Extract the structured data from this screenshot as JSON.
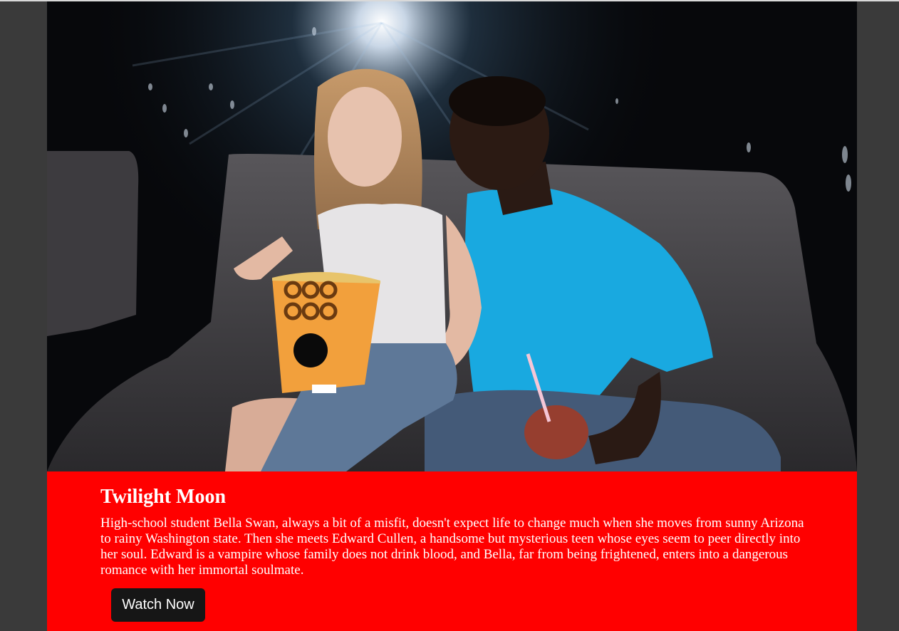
{
  "movie": {
    "title": "Twilight Moon",
    "description": "High-school student Bella Swan, always a bit of a misfit, doesn't expect life to change much when she moves from sunny Arizona to rainy Washington state. Then she meets Edward Cullen, a handsome but mysterious teen whose eyes seem to peer directly into her soul. Edward is a vampire whose family does not drink blood, and Bella, far from being frightened, enters into a dangerous romance with her immortal soulmate.",
    "watch_label": "Watch Now"
  },
  "colors": {
    "page_background": "#3a3a3a",
    "info_panel": "#ff0000",
    "button_background": "#161616",
    "text": "#ffffff"
  }
}
